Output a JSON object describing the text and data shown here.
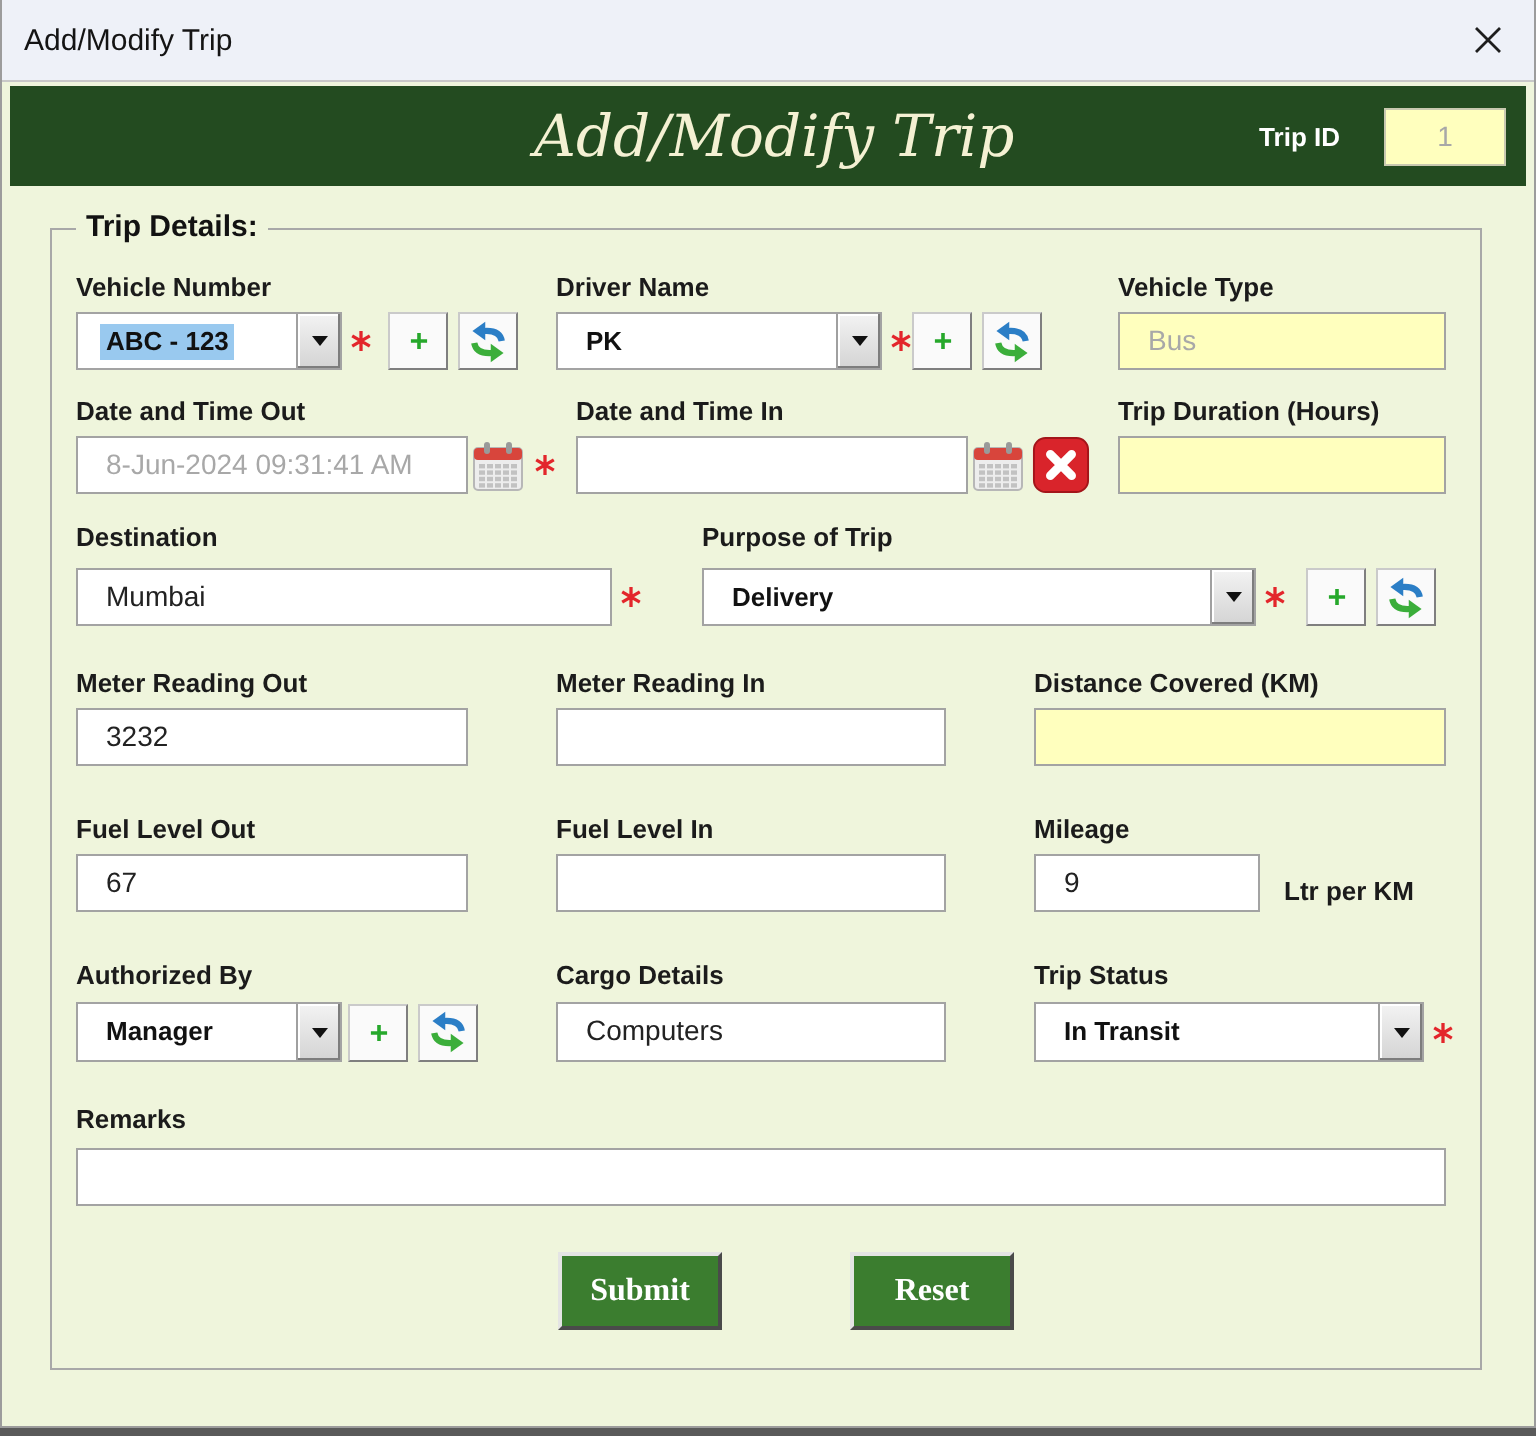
{
  "window": {
    "title": "Add/Modify Trip"
  },
  "header": {
    "title": "Add/Modify Trip",
    "trip_id": {
      "label": "Trip ID",
      "value": "1",
      "readonly": true,
      "disabled": true
    }
  },
  "trip_details": {
    "legend": "Trip Details:",
    "rows": [
      {
        "fields": [
          {
            "kind": "dropdown",
            "label": "Vehicle Number",
            "value": "ABC - 123",
            "text_selected": true,
            "required": true,
            "add_button": true,
            "refresh_button": true
          },
          {
            "kind": "dropdown",
            "label": "Driver Name",
            "value": "PK",
            "text_selected": false,
            "required": true,
            "add_button": true,
            "refresh_button": true
          },
          {
            "kind": "text",
            "label": "Vehicle Type",
            "value": "Bus",
            "readonly": true,
            "disabled": true
          }
        ]
      },
      {
        "fields": [
          {
            "kind": "text",
            "label": "Date and Time Out",
            "value": "8-Jun-2024 09:31:41 AM",
            "readonly": false,
            "disabled": true,
            "calendar_button": true,
            "required": true
          },
          {
            "kind": "text",
            "label": "Date and Time In",
            "readonly": false,
            "calendar_button": true,
            "clear_button": true
          },
          {
            "kind": "text",
            "label": "Trip Duration (Hours)",
            "readonly": true
          }
        ]
      },
      {
        "fields": [
          {
            "kind": "text",
            "label": "Destination",
            "value": "Mumbai",
            "readonly": false,
            "disabled": false,
            "required": true
          },
          {
            "kind": "dropdown",
            "label": "Purpose of Trip",
            "value": "Delivery",
            "text_selected": false,
            "required": true,
            "add_button": true,
            "refresh_button": true
          }
        ]
      },
      {
        "fields": [
          {
            "kind": "text",
            "label": "Meter Reading Out",
            "value": "3232",
            "readonly": false,
            "disabled": false
          },
          {
            "kind": "text",
            "label": "Meter Reading In",
            "readonly": false
          },
          {
            "kind": "text",
            "label": "Distance Covered (KM)",
            "readonly": true
          }
        ]
      },
      {
        "fields": [
          {
            "kind": "text",
            "label": "Fuel Level Out",
            "value": "67",
            "readonly": false,
            "disabled": false
          },
          {
            "kind": "text",
            "label": "Fuel Level In",
            "readonly": false
          },
          {
            "kind": "text",
            "label": "Mileage",
            "value": "9",
            "readonly": false,
            "disabled": false,
            "unit": "Ltr per KM"
          }
        ]
      },
      {
        "fields": [
          {
            "kind": "dropdown",
            "label": "Authorized By",
            "value": "Manager",
            "text_selected": false,
            "add_button": true,
            "refresh_button": true
          },
          {
            "kind": "text",
            "label": "Cargo Details",
            "value": "Computers",
            "readonly": false,
            "disabled": false
          },
          {
            "kind": "dropdown",
            "label": "Trip Status",
            "value": "In Transit",
            "text_selected": false,
            "required": true
          }
        ]
      },
      {
        "fields": [
          {
            "kind": "text",
            "label": "Remarks",
            "readonly": false
          }
        ]
      }
    ],
    "buttons": [
      {
        "label": "Submit"
      },
      {
        "label": "Reset"
      }
    ]
  }
}
